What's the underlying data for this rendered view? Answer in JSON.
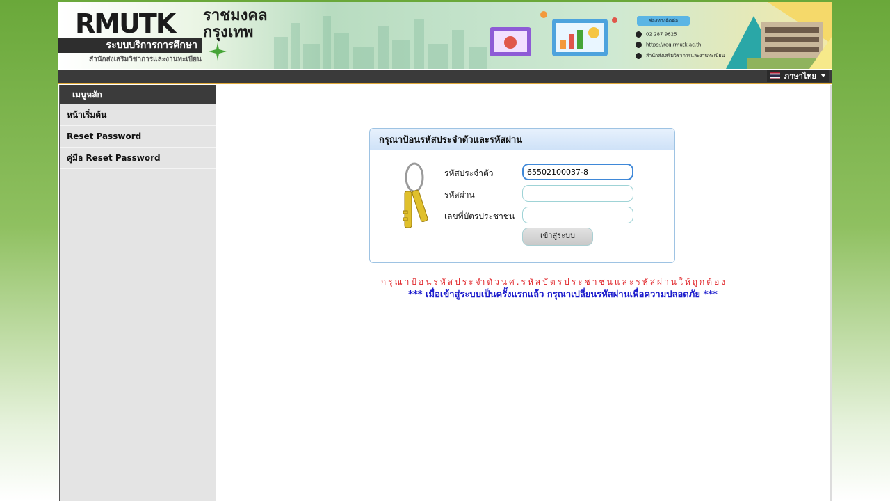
{
  "header": {
    "logo_text_left": "RMUTK",
    "logo_thai_line1": "ราชมงคล",
    "logo_thai_line2": "กรุงเทพ",
    "system_name": "ระบบบริการการศึกษา",
    "office_name": "สำนักส่งเสริมวิชาการและงานทะเบียน",
    "contact_title": "ช่องทางติดต่อ",
    "contact_phone": "02 287 9625",
    "contact_web": "https://reg.rmutk.ac.th",
    "contact_office": "สำนักส่งเสริมวิชาการและงานทะเบียน"
  },
  "topbar": {
    "language_label": "ภาษาไทย"
  },
  "sidebar": {
    "title": "เมนูหลัก",
    "items": [
      {
        "label": "หน้าเริ่มต้น"
      },
      {
        "label": "Reset Password"
      },
      {
        "label": "คู่มือ Reset Password"
      }
    ]
  },
  "login": {
    "title": "กรุณาป้อนรหัสประจำตัวและรหัสผ่าน",
    "student_id_label": "รหัสประจำตัว",
    "student_id_value": "65502100037-8",
    "password_label": "รหัสผ่าน",
    "password_value": "",
    "citizen_id_label": "เลขที่บัตรประชาชน",
    "citizen_id_value": "",
    "submit_label": "เข้าสู่ระบบ"
  },
  "messages": {
    "error": "กรุณาป้อนรหัสประจำตัวนศ.รหัสบัตรประชาชนและรหัสผ่านให้ถูกต้อง",
    "note": "*** เมื่อเข้าสู่ระบบเป็นครั้งแรกแล้ว กรุณาเปลี่ยนรหัสผ่านเพื่อความปลอดภัย ***"
  },
  "colors": {
    "error": "#e0262a",
    "note": "#1c1ccc",
    "brand_green": "#46a537",
    "accent_orange": "#e0a93a"
  }
}
